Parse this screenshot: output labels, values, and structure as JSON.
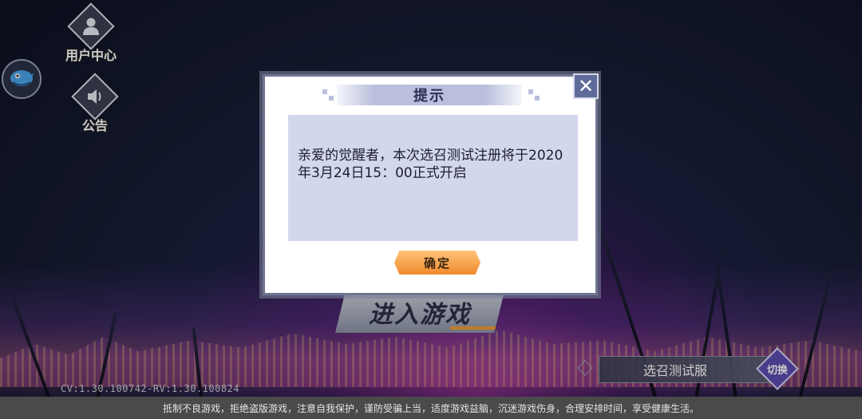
{
  "sidebar": {
    "user_center_label": "用户中心",
    "announcement_label": "公告",
    "avatar_icon": "bird-icon",
    "user_icon": "user-icon",
    "speaker_icon": "speaker-icon"
  },
  "main": {
    "enter_game_label": "进入游戏",
    "server_name": "选召测试服",
    "switch_label": "切换"
  },
  "version": "CV:1.30.100742-RV:1.30.100824",
  "footer": {
    "notice": "抵制不良游戏，拒绝盗版游戏，注意自我保护，谨防受骗上当，适度游戏益脑，沉迷游戏伤身，合理安排时间，享受健康生活。"
  },
  "dialog": {
    "title": "提示",
    "message": "亲爱的觉醒者，本次选召测试注册将于2020年3月24日15：00正式开启",
    "confirm_label": "确定",
    "close_icon": "close-icon"
  },
  "colors": {
    "accent_orange": "#f08a2c",
    "dialog_border": "#6f7590",
    "message_bg": "#d3d7ee",
    "switch_purple": "#5a4bb0"
  }
}
